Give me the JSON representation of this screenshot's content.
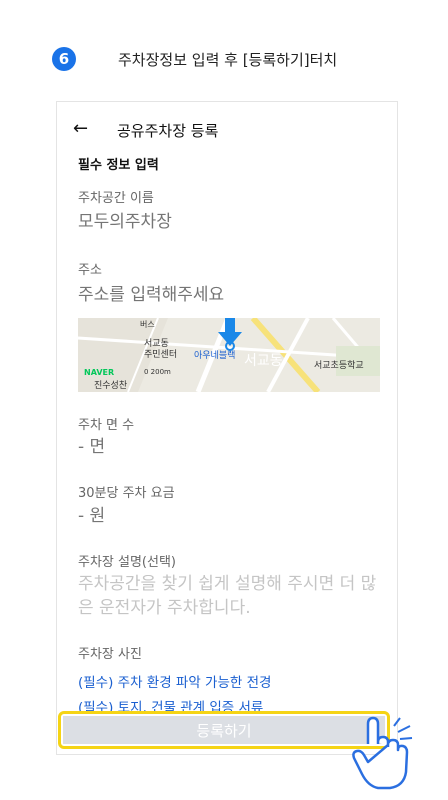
{
  "instruction": {
    "step_number": "6",
    "text": "주차장정보 입력 후 [등록하기]터치"
  },
  "header": {
    "back_icon": "←",
    "title": "공유주차장 등록"
  },
  "section_title": "필수 정보 입력",
  "fields": {
    "space_name": {
      "label": "주차공간 이름",
      "placeholder": "모두의주차장"
    },
    "address": {
      "label": "주소",
      "placeholder": "주소를 입력해주세요"
    },
    "spots": {
      "label": "주차 면 수",
      "placeholder": "- 면"
    },
    "fee": {
      "label": "30분당 주차 요금",
      "placeholder": "- 원"
    },
    "description": {
      "label": "주차장 설명(선택)",
      "placeholder": "주차공간을 찾기 쉽게 설명해 주시면 더 많은 운전자가 주차합니다."
    },
    "photos": {
      "label": "주차장 사진"
    }
  },
  "map": {
    "labels": {
      "community_center": "서교동\n주민센터",
      "building": "아우네블랙",
      "district": "서교동",
      "school": "서교초등학교",
      "naver": "NAVER",
      "scale": "0    200m",
      "shop": "진수성찬",
      "top": "버스"
    }
  },
  "photo_links": {
    "environment": "(필수) 주차 환경 파악 가능한 전경",
    "documents": "(필수) 토지, 건물 관계 입증 서류"
  },
  "submit_label": "등록하기",
  "colors": {
    "badge": "#1a73e8",
    "highlight": "#f5d415",
    "link": "#1a5fd0",
    "map_pin": "#1a88e8"
  }
}
